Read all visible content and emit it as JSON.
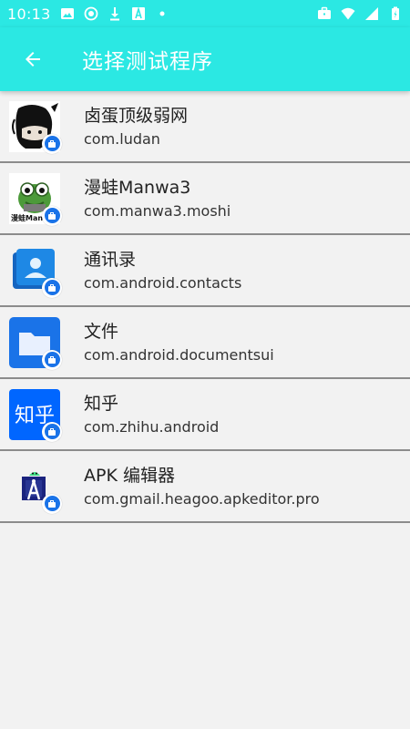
{
  "status_bar": {
    "time": "10:13",
    "left_icons": [
      "image-icon",
      "record-icon",
      "download-icon",
      "font-icon",
      "dot-icon"
    ],
    "right_icons": [
      "work-profile-icon",
      "wifi-icon",
      "signal-icon",
      "battery-icon"
    ]
  },
  "app_bar": {
    "title": "选择测试程序",
    "color": "#2be8e3"
  },
  "apps": [
    {
      "name": "卤蛋顶级弱网",
      "package": "com.ludan",
      "icon": "ludan-icon"
    },
    {
      "name": "漫蛙Manwa3",
      "package": "com.manwa3.moshi",
      "icon": "manwa-icon"
    },
    {
      "name": "通讯录",
      "package": "com.android.contacts",
      "icon": "contacts-icon"
    },
    {
      "name": "文件",
      "package": "com.android.documentsui",
      "icon": "files-icon"
    },
    {
      "name": "知乎",
      "package": "com.zhihu.android",
      "icon": "zhihu-icon",
      "icon_text": "知乎"
    },
    {
      "name": "APK 编辑器",
      "package": "com.gmail.heagoo.apkeditor.pro",
      "icon": "apkeditor-icon"
    }
  ]
}
